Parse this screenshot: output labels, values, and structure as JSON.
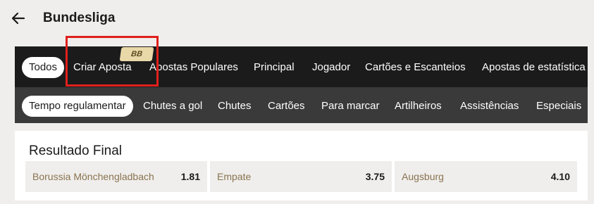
{
  "header": {
    "back_icon": "arrow-left-icon",
    "title": "Bundesliga"
  },
  "primary_tabs": [
    {
      "label": "Todos",
      "selected": true
    },
    {
      "label": "Criar Aposta",
      "selected": false
    },
    {
      "label": "Apostas Populares",
      "selected": false
    },
    {
      "label": "Principal",
      "selected": false
    },
    {
      "label": "Jogador",
      "selected": false
    },
    {
      "label": "Cartões e Escanteios",
      "selected": false
    },
    {
      "label": "Apostas de estatística",
      "selected": false
    }
  ],
  "badge": {
    "label": "BB"
  },
  "secondary_tabs": [
    {
      "label": "Tempo regulamentar",
      "selected": true
    },
    {
      "label": "Chutes a gol",
      "selected": false
    },
    {
      "label": "Chutes",
      "selected": false
    },
    {
      "label": "Cartões",
      "selected": false
    },
    {
      "label": "Para marcar",
      "selected": false
    },
    {
      "label": "Artilheiros",
      "selected": false
    },
    {
      "label": "Assistências",
      "selected": false
    },
    {
      "label": "Especiais",
      "selected": false
    }
  ],
  "market": {
    "title": "Resultado Final",
    "outcomes": [
      {
        "name": "Borussia Mönchengladbach",
        "price": "1.81"
      },
      {
        "name": "Empate",
        "price": "3.75"
      },
      {
        "name": "Augsburg",
        "price": "4.10"
      }
    ]
  },
  "colors": {
    "background": "#efeeec",
    "primary_tab_bar": "#1b1b1b",
    "secondary_tab_bar": "#3a3a3a",
    "highlight": "#e0201c",
    "outcome_name": "#8a7350"
  }
}
